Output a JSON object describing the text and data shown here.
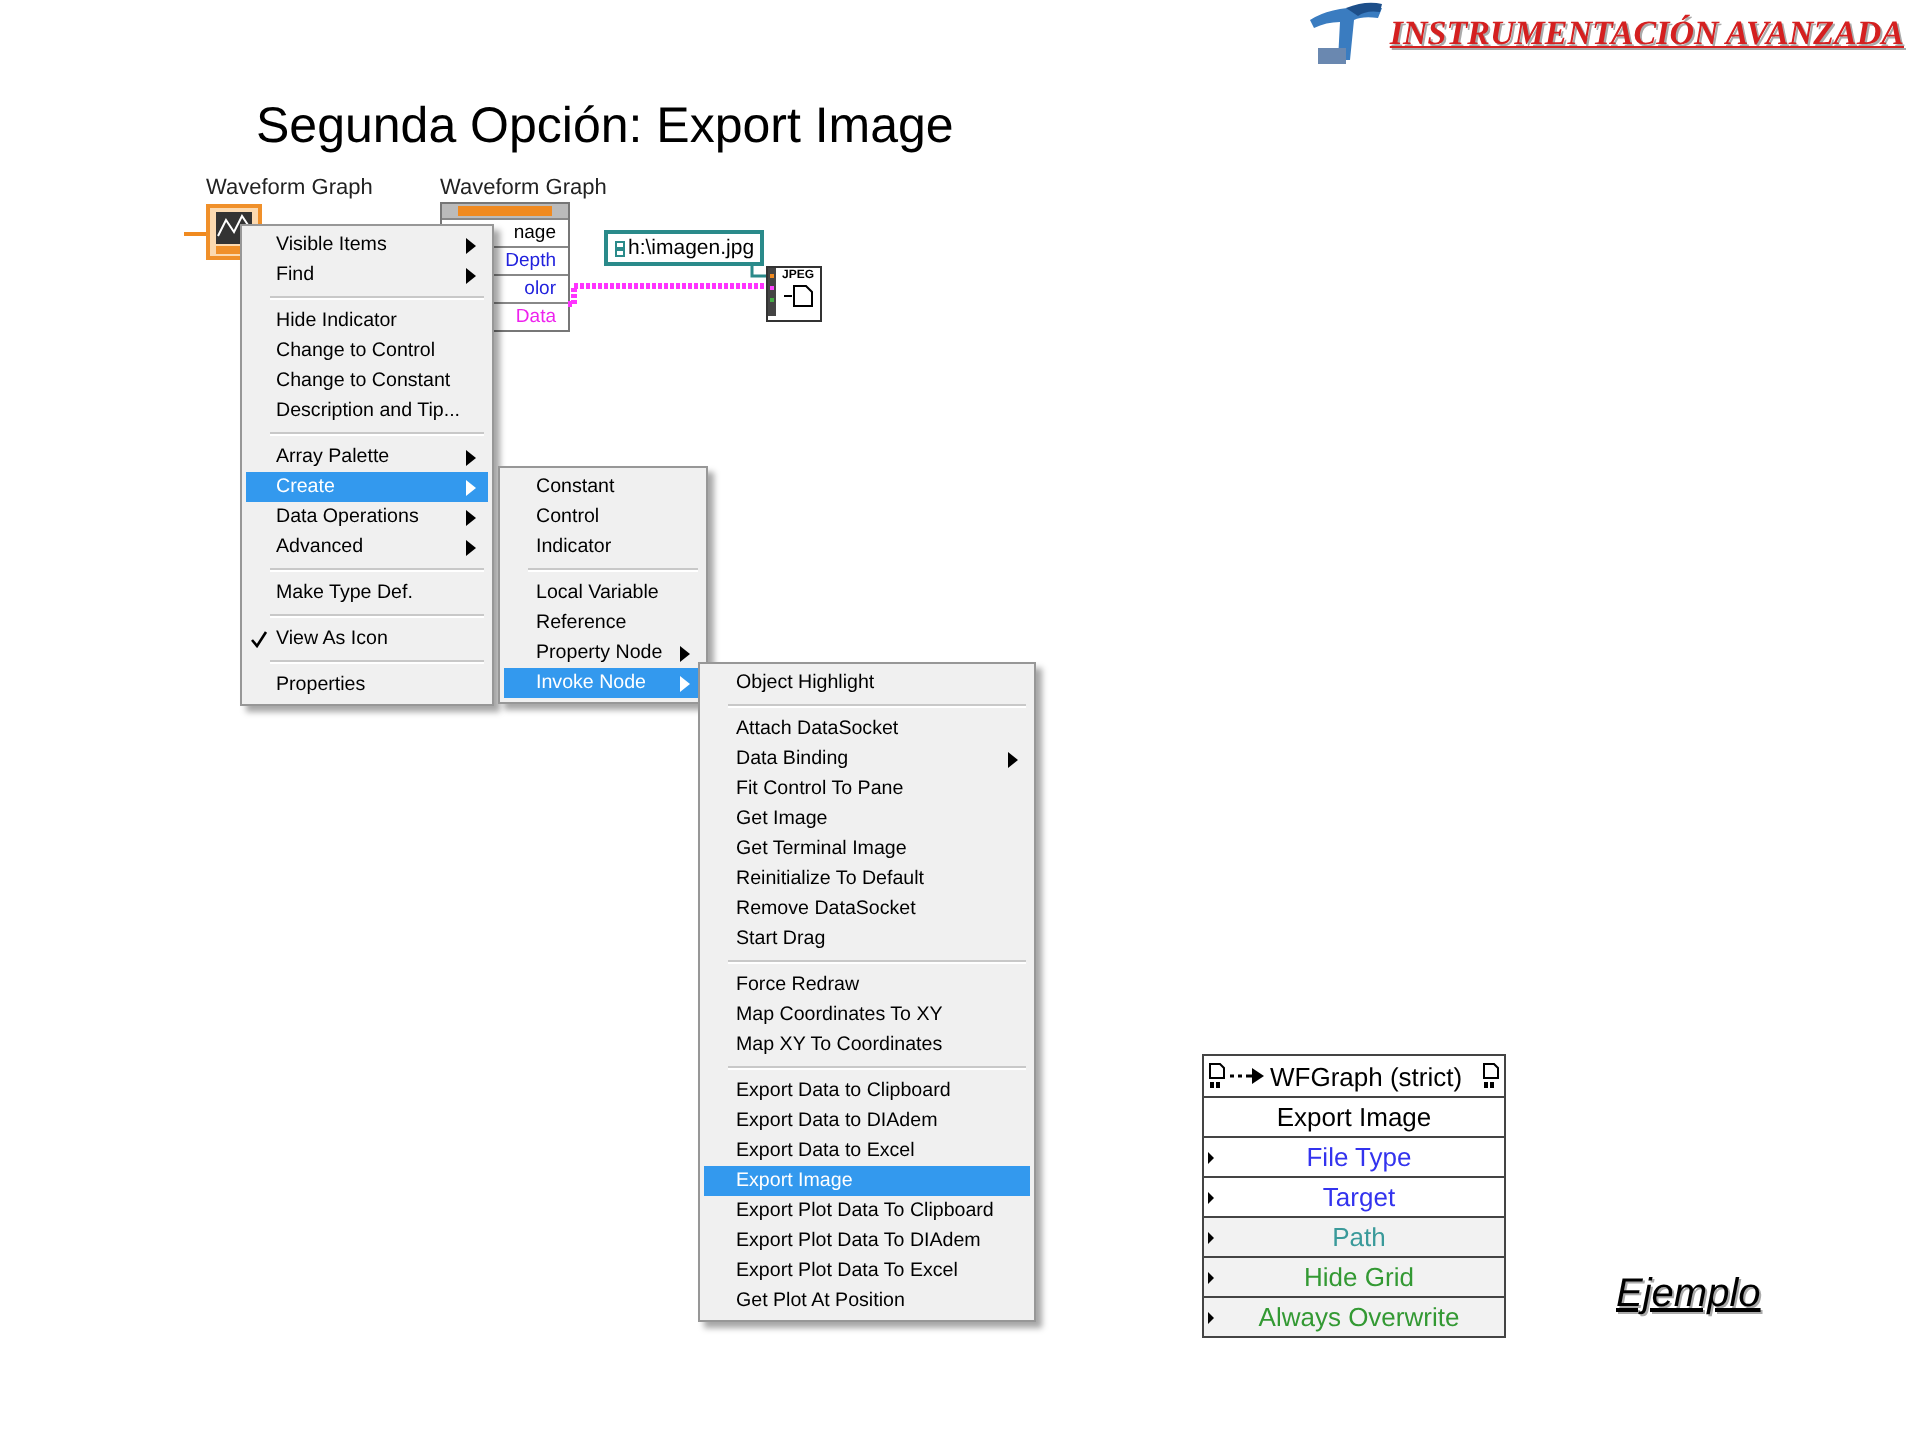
{
  "header": {
    "logo_text": "INSTRUMENTACIÓN AVANZADA",
    "title": "Segunda Opción: Export Image"
  },
  "diagram": {
    "graph_terminal_label": "Waveform Graph",
    "property_node": {
      "title": "Waveform Graph",
      "items": [
        {
          "label": "nage",
          "color": "#000000"
        },
        {
          "label": "Depth",
          "color": "#2222dd"
        },
        {
          "label": "olor",
          "color": "#2222dd"
        },
        {
          "label": "Data",
          "color": "#ee22ee"
        }
      ]
    },
    "path_constant": "h:\\imagen.jpg",
    "jpeg_icon_label": "JPEG"
  },
  "menus": [
    {
      "groups": [
        [
          {
            "label": "Visible Items",
            "has_submenu": true,
            "checked": false,
            "selected": false
          },
          {
            "label": "Find",
            "has_submenu": true,
            "checked": false,
            "selected": false
          }
        ],
        [
          {
            "label": "Hide Indicator",
            "has_submenu": false,
            "checked": false,
            "selected": false
          },
          {
            "label": "Change to Control",
            "has_submenu": false,
            "checked": false,
            "selected": false
          },
          {
            "label": "Change to Constant",
            "has_submenu": false,
            "checked": false,
            "selected": false
          },
          {
            "label": "Description and Tip...",
            "has_submenu": false,
            "checked": false,
            "selected": false
          }
        ],
        [
          {
            "label": "Array Palette",
            "has_submenu": true,
            "checked": false,
            "selected": false
          },
          {
            "label": "Create",
            "has_submenu": true,
            "checked": false,
            "selected": true
          },
          {
            "label": "Data Operations",
            "has_submenu": true,
            "checked": false,
            "selected": false
          },
          {
            "label": "Advanced",
            "has_submenu": true,
            "checked": false,
            "selected": false
          }
        ],
        [
          {
            "label": "Make Type Def.",
            "has_submenu": false,
            "checked": false,
            "selected": false
          }
        ],
        [
          {
            "label": "View As Icon",
            "has_submenu": false,
            "checked": true,
            "selected": false
          }
        ],
        [
          {
            "label": "Properties",
            "has_submenu": false,
            "checked": false,
            "selected": false
          }
        ]
      ]
    },
    {
      "groups": [
        [
          {
            "label": "Constant",
            "has_submenu": false,
            "selected": false
          },
          {
            "label": "Control",
            "has_submenu": false,
            "selected": false
          },
          {
            "label": "Indicator",
            "has_submenu": false,
            "selected": false
          }
        ],
        [
          {
            "label": "Local Variable",
            "has_submenu": false,
            "selected": false
          },
          {
            "label": "Reference",
            "has_submenu": false,
            "selected": false
          },
          {
            "label": "Property Node",
            "has_submenu": true,
            "selected": false
          },
          {
            "label": "Invoke Node",
            "has_submenu": true,
            "selected": true
          }
        ]
      ]
    },
    {
      "groups": [
        [
          {
            "label": "Object Highlight",
            "has_submenu": false,
            "selected": false
          }
        ],
        [
          {
            "label": "Attach DataSocket",
            "has_submenu": false,
            "selected": false
          },
          {
            "label": "Data Binding",
            "has_submenu": true,
            "selected": false
          },
          {
            "label": "Fit Control To Pane",
            "has_submenu": false,
            "selected": false
          },
          {
            "label": "Get Image",
            "has_submenu": false,
            "selected": false
          },
          {
            "label": "Get Terminal Image",
            "has_submenu": false,
            "selected": false
          },
          {
            "label": "Reinitialize To Default",
            "has_submenu": false,
            "selected": false
          },
          {
            "label": "Remove DataSocket",
            "has_submenu": false,
            "selected": false
          },
          {
            "label": "Start Drag",
            "has_submenu": false,
            "selected": false
          }
        ],
        [
          {
            "label": "Force Redraw",
            "has_submenu": false,
            "selected": false
          },
          {
            "label": "Map Coordinates To XY",
            "has_submenu": false,
            "selected": false
          },
          {
            "label": "Map XY To Coordinates",
            "has_submenu": false,
            "selected": false
          }
        ],
        [
          {
            "label": "Export Data to Clipboard",
            "has_submenu": false,
            "selected": false
          },
          {
            "label": "Export Data to DIAdem",
            "has_submenu": false,
            "selected": false
          },
          {
            "label": "Export Data to Excel",
            "has_submenu": false,
            "selected": false
          },
          {
            "label": "Export Image",
            "has_submenu": false,
            "selected": true
          },
          {
            "label": "Export Plot Data To Clipboard",
            "has_submenu": false,
            "selected": false
          },
          {
            "label": "Export Plot Data To DIAdem",
            "has_submenu": false,
            "selected": false
          },
          {
            "label": "Export Plot Data To Excel",
            "has_submenu": false,
            "selected": false
          },
          {
            "label": "Get Plot At Position",
            "has_submenu": false,
            "selected": false
          }
        ]
      ]
    }
  ],
  "invoke_node": {
    "title": "WFGraph (strict)",
    "method": "Export Image",
    "parameters": [
      {
        "label": "File Type",
        "color": "#3333ee"
      },
      {
        "label": "Target",
        "color": "#3333ee"
      },
      {
        "label": "Path",
        "color": "#3a9a9a"
      },
      {
        "label": "Hide Grid",
        "color": "#339933"
      },
      {
        "label": "Always Overwrite",
        "color": "#339933"
      }
    ]
  },
  "example_link": "Ejemplo"
}
